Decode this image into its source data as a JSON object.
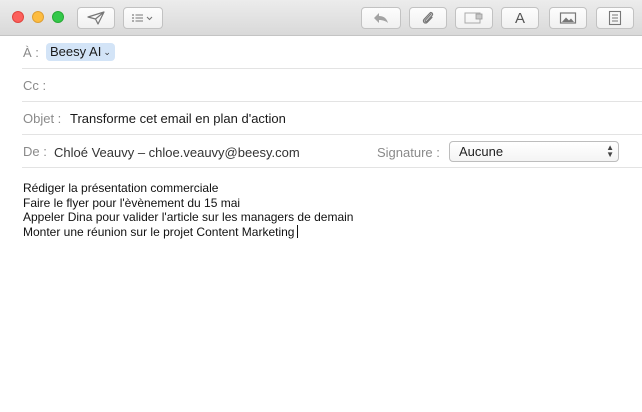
{
  "toolbar": {
    "buttons": [
      {
        "name": "send-button",
        "icon": "paper-plane-icon"
      },
      {
        "name": "header-fields-button",
        "icon": "list-icon"
      },
      {
        "name": "reply-button",
        "icon": "reply-arrow-icon"
      },
      {
        "name": "attach-button",
        "icon": "paperclip-icon"
      },
      {
        "name": "browser-button",
        "icon": "browser-icon"
      },
      {
        "name": "fonts-button",
        "icon": "font-icon",
        "label": "A"
      },
      {
        "name": "photo-button",
        "icon": "photo-icon"
      },
      {
        "name": "format-button",
        "icon": "format-icon"
      }
    ]
  },
  "header": {
    "to_label": "À :",
    "to_recipient": "Beesy AI",
    "cc_label": "Cc :",
    "subject_label": "Objet :",
    "subject_value": "Transforme cet email en plan d'action",
    "from_label": "De :",
    "from_value": "Chloé Veauvy – chloe.veauvy@beesy.com",
    "signature_label": "Signature :",
    "signature_value": "Aucune"
  },
  "body": {
    "lines": [
      "Rédiger la présentation commerciale",
      "Faire le flyer pour l'èvènement du 15 mai",
      "Appeler Dina pour valider l'article sur les managers de demain",
      "Monter une réunion sur le projet Content Marketing"
    ]
  },
  "colors": {
    "close": "#fc605c",
    "minimize": "#fdbc40",
    "maximize": "#34c84a",
    "recipient_chip": "#d3e4f7"
  }
}
